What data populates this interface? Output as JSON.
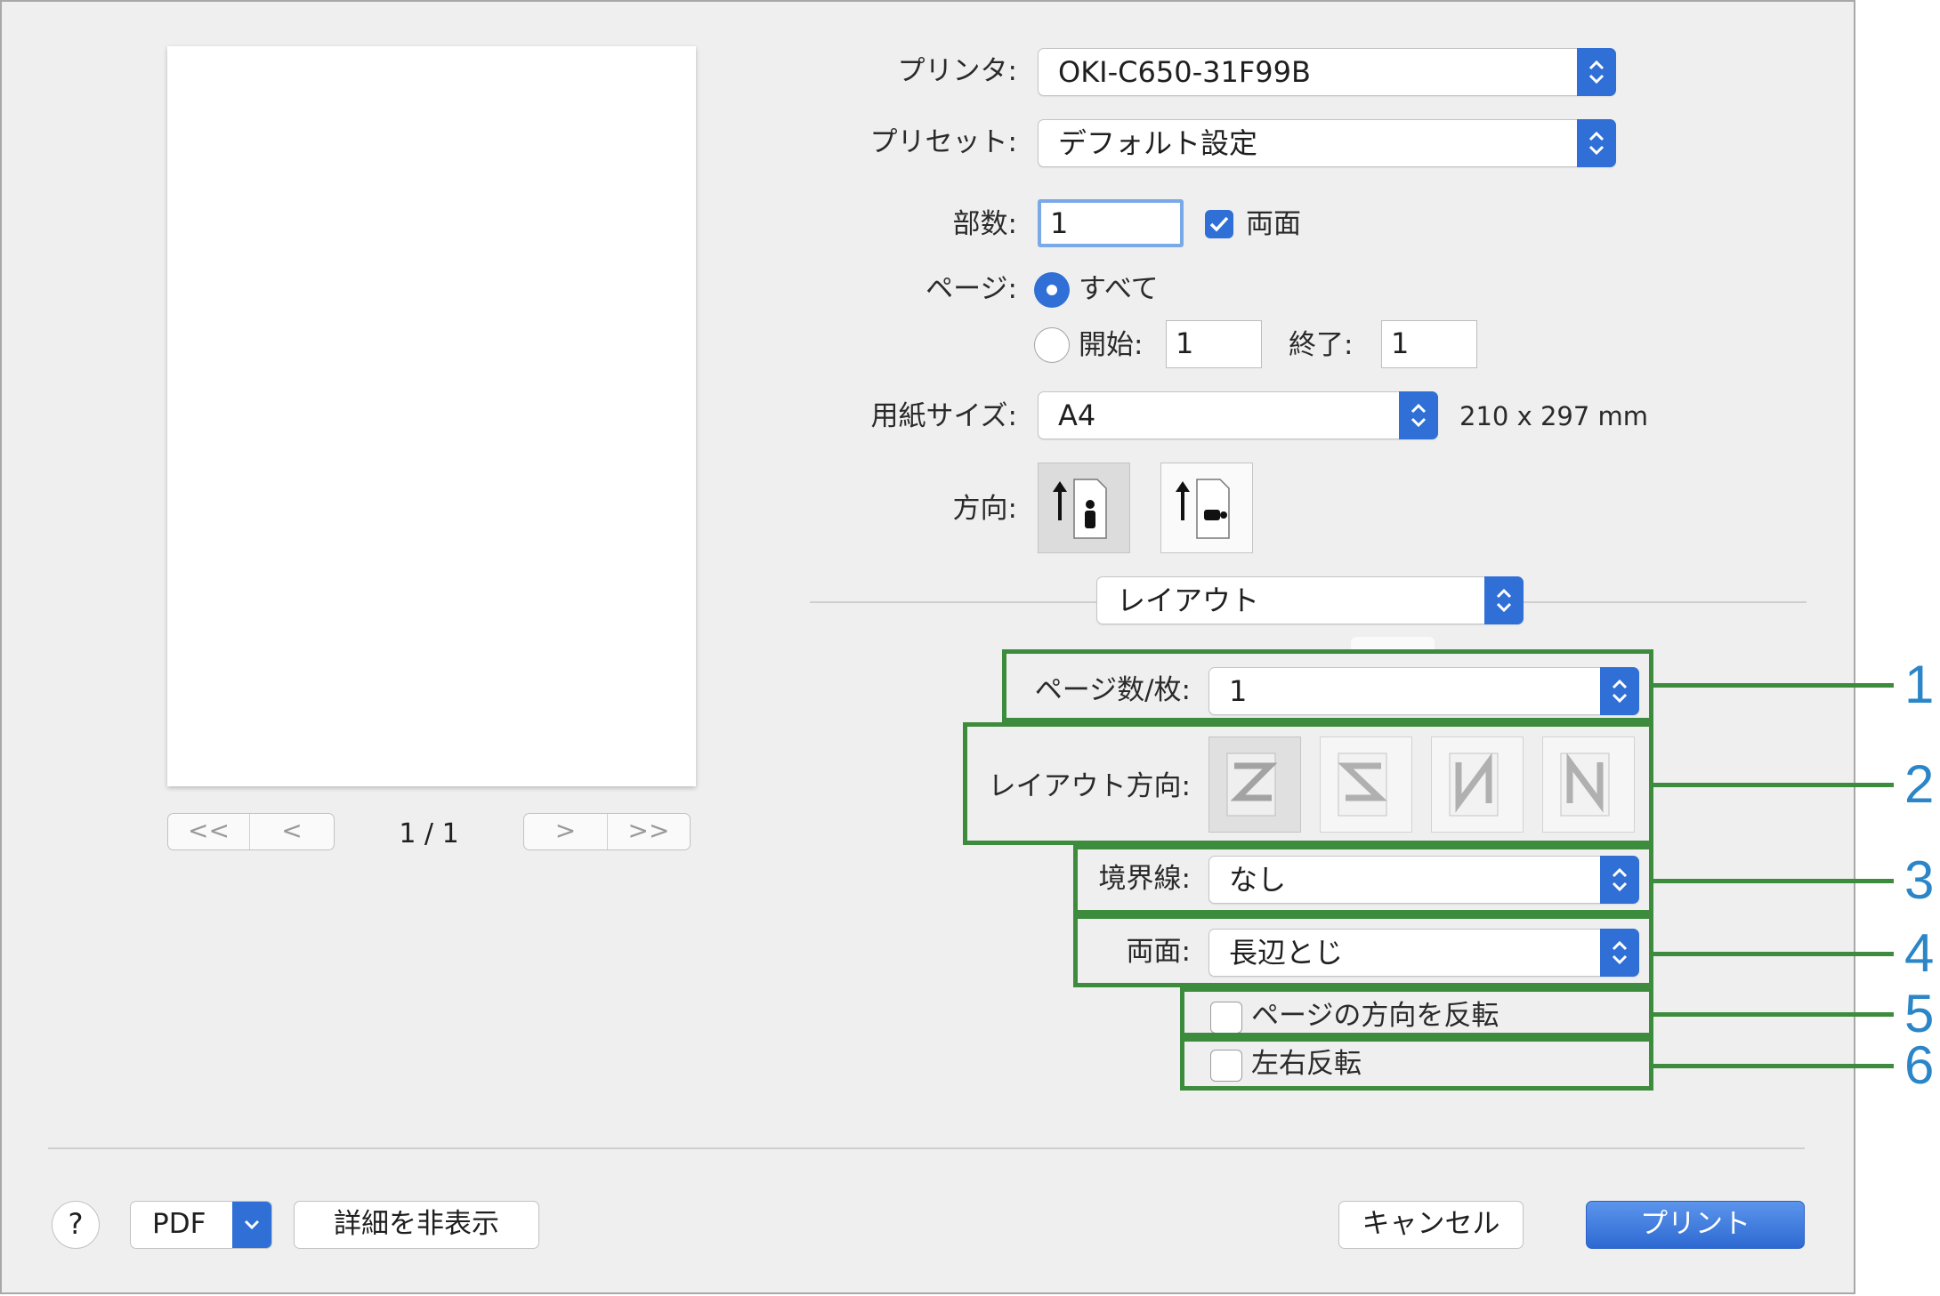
{
  "print_dialog": {
    "printer": {
      "label": "プリンタ:",
      "value": "OKI-C650-31F99B"
    },
    "preset": {
      "label": "プリセット:",
      "value": "デフォルト設定"
    },
    "copies": {
      "label": "部数:",
      "value": "1",
      "duplex_label": "両面",
      "duplex_checked": true
    },
    "pages": {
      "label": "ページ:",
      "all_label": "すべて",
      "from_label": "開始:",
      "from_value": "1",
      "to_label": "終了:",
      "to_value": "1",
      "selected": "all"
    },
    "paper_size": {
      "label": "用紙サイズ:",
      "value": "A4",
      "dimensions": "210 x 297 mm"
    },
    "orientation": {
      "label": "方向:",
      "selected": "portrait"
    },
    "section_popup": {
      "value": "レイアウト"
    },
    "layout": {
      "pages_per_sheet": {
        "label": "ページ数/枚:",
        "value": "1"
      },
      "layout_direction": {
        "label": "レイアウト方向:"
      },
      "border": {
        "label": "境界線:",
        "value": "なし"
      },
      "two_sided": {
        "label": "両面:",
        "value": "長辺とじ"
      },
      "reverse_page_orientation": {
        "label": "ページの方向を反転",
        "checked": false
      },
      "flip_horizontally": {
        "label": "左右反転",
        "checked": false
      }
    },
    "preview": {
      "page_indicator": "1 / 1",
      "nav_first": "<<",
      "nav_prev": "<",
      "nav_next": ">",
      "nav_last": ">>"
    },
    "footer": {
      "help": "?",
      "pdf": "PDF",
      "hide_details": "詳細を非表示",
      "cancel": "キャンセル",
      "print": "プリント"
    }
  },
  "callouts": [
    "1",
    "2",
    "3",
    "4",
    "5",
    "6"
  ],
  "colors": {
    "accent": "#2f6fd6",
    "callout_box": "#3d8b3d",
    "callout_number": "#2b86c8"
  },
  "icons": [
    "chevron-updown-icon",
    "checkmark-icon",
    "portrait-orientation-icon",
    "landscape-orientation-icon",
    "chevron-down-icon"
  ]
}
